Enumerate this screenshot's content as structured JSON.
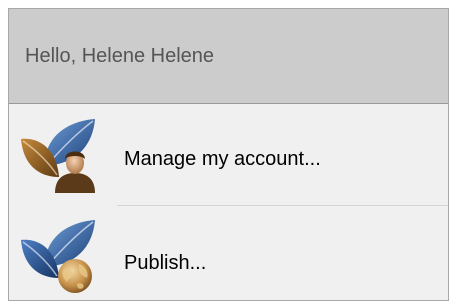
{
  "header": {
    "greeting": "Hello, Helene Helene"
  },
  "menu": {
    "items": [
      {
        "label": "Manage my account...",
        "icon": "leaf-user-icon"
      },
      {
        "label": "Publish...",
        "icon": "leaf-globe-icon"
      }
    ]
  },
  "colors": {
    "header_bg": "#cccccc",
    "menu_bg": "#f0f0f0",
    "leaf_blue": "#2b5a9c",
    "leaf_brown": "#8b5a1e"
  }
}
